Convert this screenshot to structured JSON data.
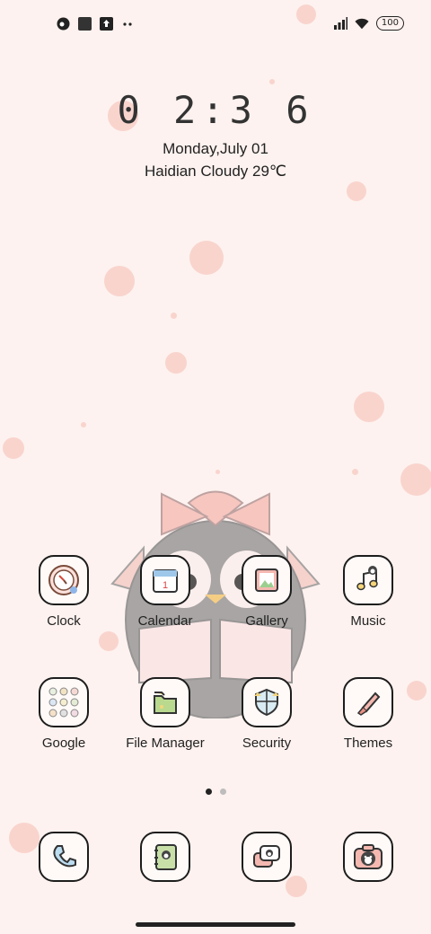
{
  "status_bar": {
    "battery": "100",
    "left_icons": [
      "app-notification-icon",
      "square-notification-icon",
      "upload-icon",
      "more-notifications-icon"
    ],
    "right_icons": [
      "signal-icon",
      "wifi-icon",
      "battery-icon"
    ]
  },
  "clock_widget": {
    "time": "0 2:3 6",
    "date": "Monday,July 01",
    "weather": "Haidian Cloudy 29℃"
  },
  "apps": [
    {
      "label": "Clock",
      "icon": "clock-icon"
    },
    {
      "label": "Calendar",
      "icon": "calendar-icon"
    },
    {
      "label": "Gallery",
      "icon": "gallery-icon"
    },
    {
      "label": "Music",
      "icon": "music-icon"
    },
    {
      "label": "Google",
      "icon": "google-folder-icon"
    },
    {
      "label": "File Manager",
      "icon": "file-manager-icon"
    },
    {
      "label": "Security",
      "icon": "security-shield-icon"
    },
    {
      "label": "Themes",
      "icon": "themes-brush-icon"
    }
  ],
  "calendar_day": "1",
  "dock": [
    {
      "icon": "phone-icon"
    },
    {
      "icon": "contacts-icon"
    },
    {
      "icon": "messages-icon"
    },
    {
      "icon": "camera-icon"
    }
  ],
  "page_indicator": {
    "pages": 2,
    "current": 1
  },
  "colors": {
    "background": "#fdf2ef",
    "accent_pink": "#f4b8b0",
    "icon_border": "#1d1d1d"
  }
}
